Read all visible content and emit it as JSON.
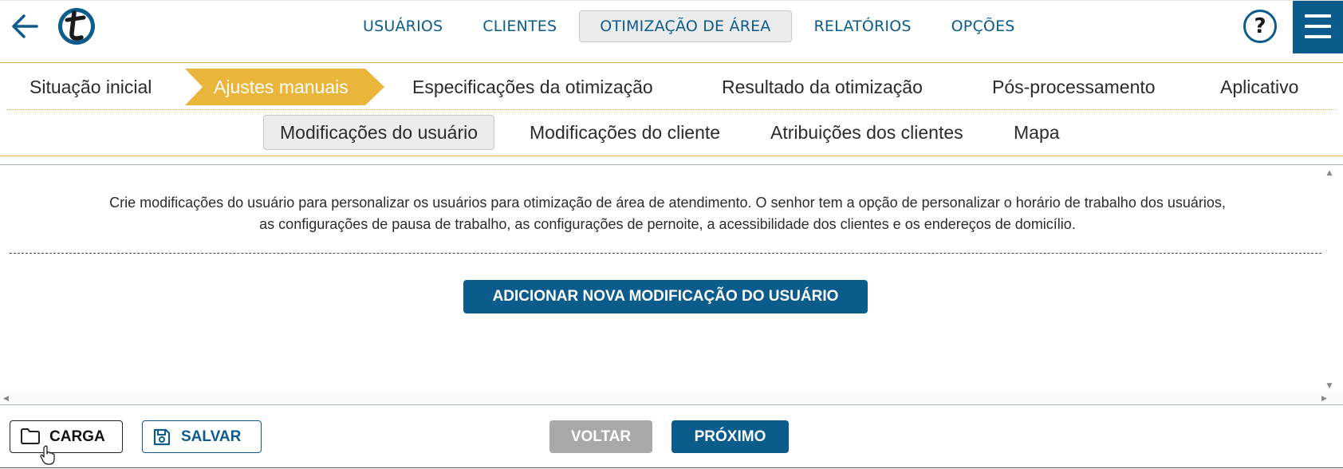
{
  "header": {
    "nav": [
      {
        "label": "USUÁRIOS",
        "active": false
      },
      {
        "label": "CLIENTES",
        "active": false
      },
      {
        "label": "OTIMIZAÇÃO DE ÁREA",
        "active": true
      },
      {
        "label": "RELATÓRIOS",
        "active": false
      },
      {
        "label": "OPÇÕES",
        "active": false
      }
    ],
    "help_label": "?",
    "icons": {
      "back": "arrow-left-icon",
      "logo": "t-logo",
      "help": "help-icon",
      "menu": "hamburger-menu-icon"
    }
  },
  "steps": [
    {
      "label": "Situação inicial",
      "active": false
    },
    {
      "label": "Ajustes manuais",
      "active": true
    },
    {
      "label": "Especificações da otimização",
      "active": false
    },
    {
      "label": "Resultado da otimização",
      "active": false
    },
    {
      "label": "Pós-processamento",
      "active": false
    },
    {
      "label": "Aplicativo",
      "active": false
    }
  ],
  "subtabs": [
    {
      "label": "Modificações do usuário",
      "active": true
    },
    {
      "label": "Modificações do cliente",
      "active": false
    },
    {
      "label": "Atribuições dos clientes",
      "active": false
    },
    {
      "label": "Mapa",
      "active": false
    }
  ],
  "content": {
    "description_line1": "Crie modificações do usuário para personalizar os usuários para otimização de área de atendimento. O senhor tem a opção de personalizar o horário de trabalho dos usuários,",
    "description_line2": "as configurações de pausa de trabalho, as configurações de pernoite, a acessibilidade dos clientes e os endereços de domicílio.",
    "add_button": "ADICIONAR NOVA MODIFICAÇÃO DO USUÁRIO"
  },
  "footer": {
    "load_label": "CARGA",
    "save_label": "SALVAR",
    "back_label": "VOLTAR",
    "next_label": "PRÓXIMO",
    "icons": {
      "load": "folder-icon",
      "save": "floppy-disk-icon"
    }
  },
  "colors": {
    "primary": "#0b5c8c",
    "step_active": "#e9b53a",
    "disabled": "#a9a9a9"
  }
}
